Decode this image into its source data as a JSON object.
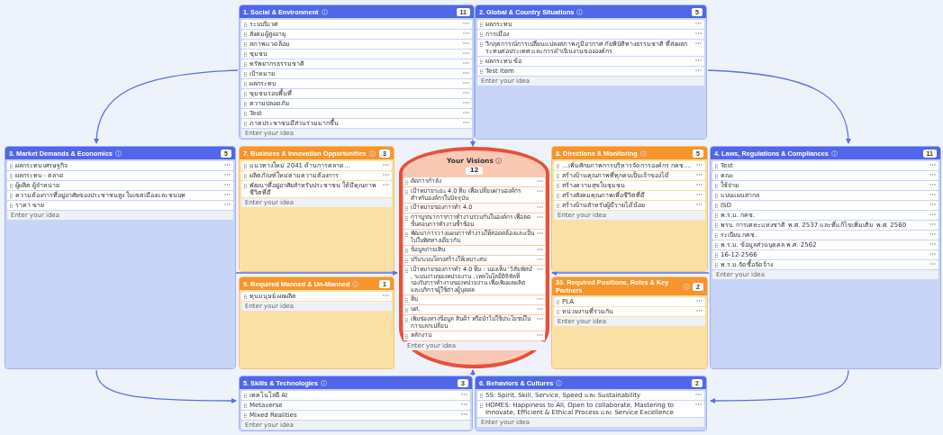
{
  "panels": [
    {
      "kind": "context",
      "title": "1. Social & Environment",
      "count": "11",
      "items": [
        "ระบบนิเวศ",
        "สังคมผู้สูงอายุ",
        "สภาพแวดล้อม",
        "ชุมชน",
        "ทรัพยากรธรรมชาติ",
        "เป้าหมาย",
        "ผลกระทบ",
        "ชุมชนรอบพื้นที่",
        "ความปลอดภัย",
        "Test",
        "ภาคประชาชนมีส่วนร่วมมากขึ้น"
      ],
      "placeholder": "Enter your idea"
    },
    {
      "kind": "context",
      "title": "2. Global & Country Situations",
      "count": "5",
      "items": [
        "ผลกระทบ",
        "การเมือง",
        "วิกฤตการณ์การเปลี่ยนแปลงสภาพภูมิอากาศ ภัยพิบัติทางธรรมชาติ ที่ส่งผลกระทบต่อประเทศ และการดำเนินงานขององค์กร",
        "ผลกระทบ ข้อ",
        "Test item"
      ],
      "placeholder": "Enter your idea"
    },
    {
      "kind": "context",
      "title": "3. Market Demands & Economics",
      "count": "5",
      "items": [
        "ผลกระทบ เศรษฐกิจ",
        "ผลกระทบ - ตลาด",
        "ผู้ผลิต ผู้จำหน่าย",
        "ความต้องการที่อยู่อาศัยของประชาชนสูง ในเขตเมืองและชนบท",
        "ราคา ขาย"
      ],
      "placeholder": "Enter your idea"
    },
    {
      "kind": "action",
      "title": "7. Business & Innovation Opportunities",
      "count": "3",
      "items": [
        "แนวทางใหม่ 2041 ด้านการตลาด...",
        "ผลิตภัณฑ์ใหม่ตามความต้องการ",
        "พัฒนาที่อยู่อาศัยสำหรับประชาชน ให้มีคุณภาพชีวิตที่ดี"
      ],
      "placeholder": "Enter your idea"
    },
    {
      "kind": "vision",
      "title": "Your Visions",
      "count": "12",
      "items": [
        "ตัดการกำลัง",
        "เป้าหมายระยะ 4.0 ทีม เพื่อเปลี่ยนผ่านองค์กรสำหรับองค์กรในปัจจุบัน",
        "เป้าหมายของการทำ 4.0",
        "การบูรณาการการทำงานร่วมกันในองค์กร เพื่อลดขั้นตอนการทำงานซ้ำซ้อน",
        "พัฒนาการวางแผนการทำงานให้สอดคล้องและเป็นไปในทิศทางเดียวกัน",
        "ข้อมูลถ่ายเทิน",
        "ปรับระบบโครงสร้างให้เหมาะสม",
        "เป้าหมายของการทำ 4.0 ทีม : มองเห็น 'วิสัยทัศน์' , ระบบงานของหน่วยงาน , เทคโนโลยีดิจิทัลที่รองรับการทำงานของหน่วยงาน เพื่อเพิ่มผลผลิต และบริการผู้ใช้ต่างผู้บุคคล",
        "ทีม",
        "นศ.",
        "เพิ่มช่องทางข้อมูล สินค้า หรือนำไปใช้ประโยชน์ในการแลกเปลี่ยน",
        "หลักงาน"
      ],
      "placeholder": "Enter your idea"
    },
    {
      "kind": "action",
      "title": "8. Directions & Monitoring",
      "count": "5",
      "items": [
        "...เพิ่มศักยภาพการบริหารจัดการองค์กร กคช....",
        "สร้างบ้านคุณภาพที่ทุกคนเป็นเจ้าของได้",
        "สร้างความสุขในชุมชน",
        "สร้างสังคมคุณภาพเพื่อชีวิตที่ดี",
        "สร้างบ้านสำหรับผู้มีรายได้น้อย"
      ],
      "placeholder": "Enter your idea"
    },
    {
      "kind": "context",
      "title": "4. Laws, Regulations & Compliances",
      "count": "11",
      "items": [
        "Test",
        "คณะ",
        "ใช้จ่าย",
        "แบบแผนสากล",
        "ISO",
        "พ.ร.บ. กคช.",
        "พรบ. การเคหะแห่งชาติ พ.ศ. 2537 และที่แก้ไขเพิ่มเติม พ.ศ. 2560",
        "ระเบียบ กคช.",
        "พ.ร.บ. ข้อมูลส่วนบุคคล พ.ศ. 2562",
        "16-12-2566",
        "พ.ร.บ.จัดซื้อจัดจ้าง"
      ],
      "placeholder": "Enter your idea"
    },
    {
      "kind": "action",
      "title": "9. Required Manned & Un-Manned",
      "count": "1",
      "items": [
        "ทุนมนุษย์ ผลผลิต"
      ],
      "placeholder": "Enter your idea"
    },
    {
      "kind": "action",
      "title": "10. Required Positions, Roles & Key Partners",
      "count": "2",
      "items": [
        "PLA",
        "หน่วยงานที่ร่วมกัน"
      ],
      "placeholder": "Enter your idea"
    },
    {
      "kind": "context",
      "title": "5. Skills & Technologies",
      "count": "3",
      "items": [
        "เทคโนโลยี AI",
        "Metaverse",
        "Mixed Realities"
      ],
      "placeholder": "Enter your idea"
    },
    {
      "kind": "context",
      "title": "6. Behaviors & Cultures",
      "count": "2",
      "items": [
        "5S: Spirit, Skill, Service, Speed และ Sustainability",
        "HOMES: Happiness to All, Open to collaborate, Mastering to Innovate, Efficient & Ethical Process และ Service Excellence"
      ],
      "placeholder": "Enter your idea"
    }
  ]
}
